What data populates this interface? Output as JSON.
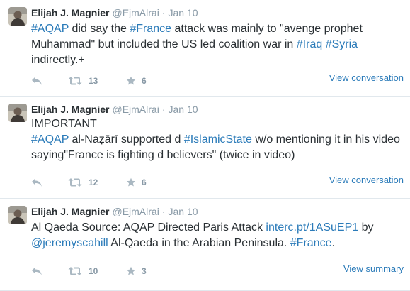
{
  "colors": {
    "link": "#2b7bb9",
    "muted": "#8899a6",
    "text": "#292f33",
    "divider": "#e1e8ed"
  },
  "tweets": [
    {
      "fullname": "Elijah J. Magnier",
      "username": "@EjmAlrai",
      "separator": "·",
      "time": "Jan 10",
      "lines": [
        [
          {
            "t": "#AQAP",
            "link": true
          },
          {
            "t": " did say the ",
            "link": false
          },
          {
            "t": "#France",
            "link": true
          },
          {
            "t": " attack was mainly to \"avenge prophet",
            "link": false
          }
        ],
        [
          {
            "t": "Muhammad\" but included the US led coalition war in ",
            "link": false
          },
          {
            "t": "#Iraq",
            "link": true
          },
          {
            "t": " ",
            "link": false
          },
          {
            "t": "#Syria",
            "link": true
          }
        ],
        [
          {
            "t": "indirectly.+",
            "link": false
          }
        ]
      ],
      "reply_icon": "reply-icon",
      "retweet_icon": "retweet-icon",
      "retweet_count": "13",
      "favorite_icon": "star-icon",
      "favorite_count": "6",
      "view_link": "View conversation"
    },
    {
      "fullname": "Elijah J. Magnier",
      "username": "@EjmAlrai",
      "separator": "·",
      "time": "Jan 10",
      "lines": [
        [
          {
            "t": "IMPORTANT",
            "link": false
          }
        ],
        [
          {
            "t": "#AQAP",
            "link": true
          },
          {
            "t": "  al-Naẓārī supported d ",
            "link": false
          },
          {
            "t": "#IslamicState",
            "link": true
          },
          {
            "t": " w/o mentioning it in his video",
            "link": false
          }
        ],
        [
          {
            "t": "saying\"France is fighting d believers\" (twice in video)",
            "link": false
          }
        ]
      ],
      "reply_icon": "reply-icon",
      "retweet_icon": "retweet-icon",
      "retweet_count": "12",
      "favorite_icon": "star-icon",
      "favorite_count": "6",
      "view_link": "View conversation"
    },
    {
      "fullname": "Elijah J. Magnier",
      "username": "@EjmAlrai",
      "separator": "·",
      "time": "Jan 10",
      "lines": [
        [
          {
            "t": "Al Qaeda Source: AQAP Directed Paris Attack ",
            "link": false
          },
          {
            "t": "interc.pt/1ASuEP1",
            "link": true
          },
          {
            "t": " by",
            "link": false
          }
        ],
        [
          {
            "t": "@jeremyscahill",
            "link": true
          },
          {
            "t": " Al-Qaeda in the Arabian Peninsula. ",
            "link": false
          },
          {
            "t": "#France",
            "link": true
          },
          {
            "t": ".",
            "link": false
          }
        ]
      ],
      "reply_icon": "reply-icon",
      "retweet_icon": "retweet-icon",
      "retweet_count": "10",
      "favorite_icon": "star-icon",
      "favorite_count": "3",
      "view_link": "View summary"
    }
  ]
}
